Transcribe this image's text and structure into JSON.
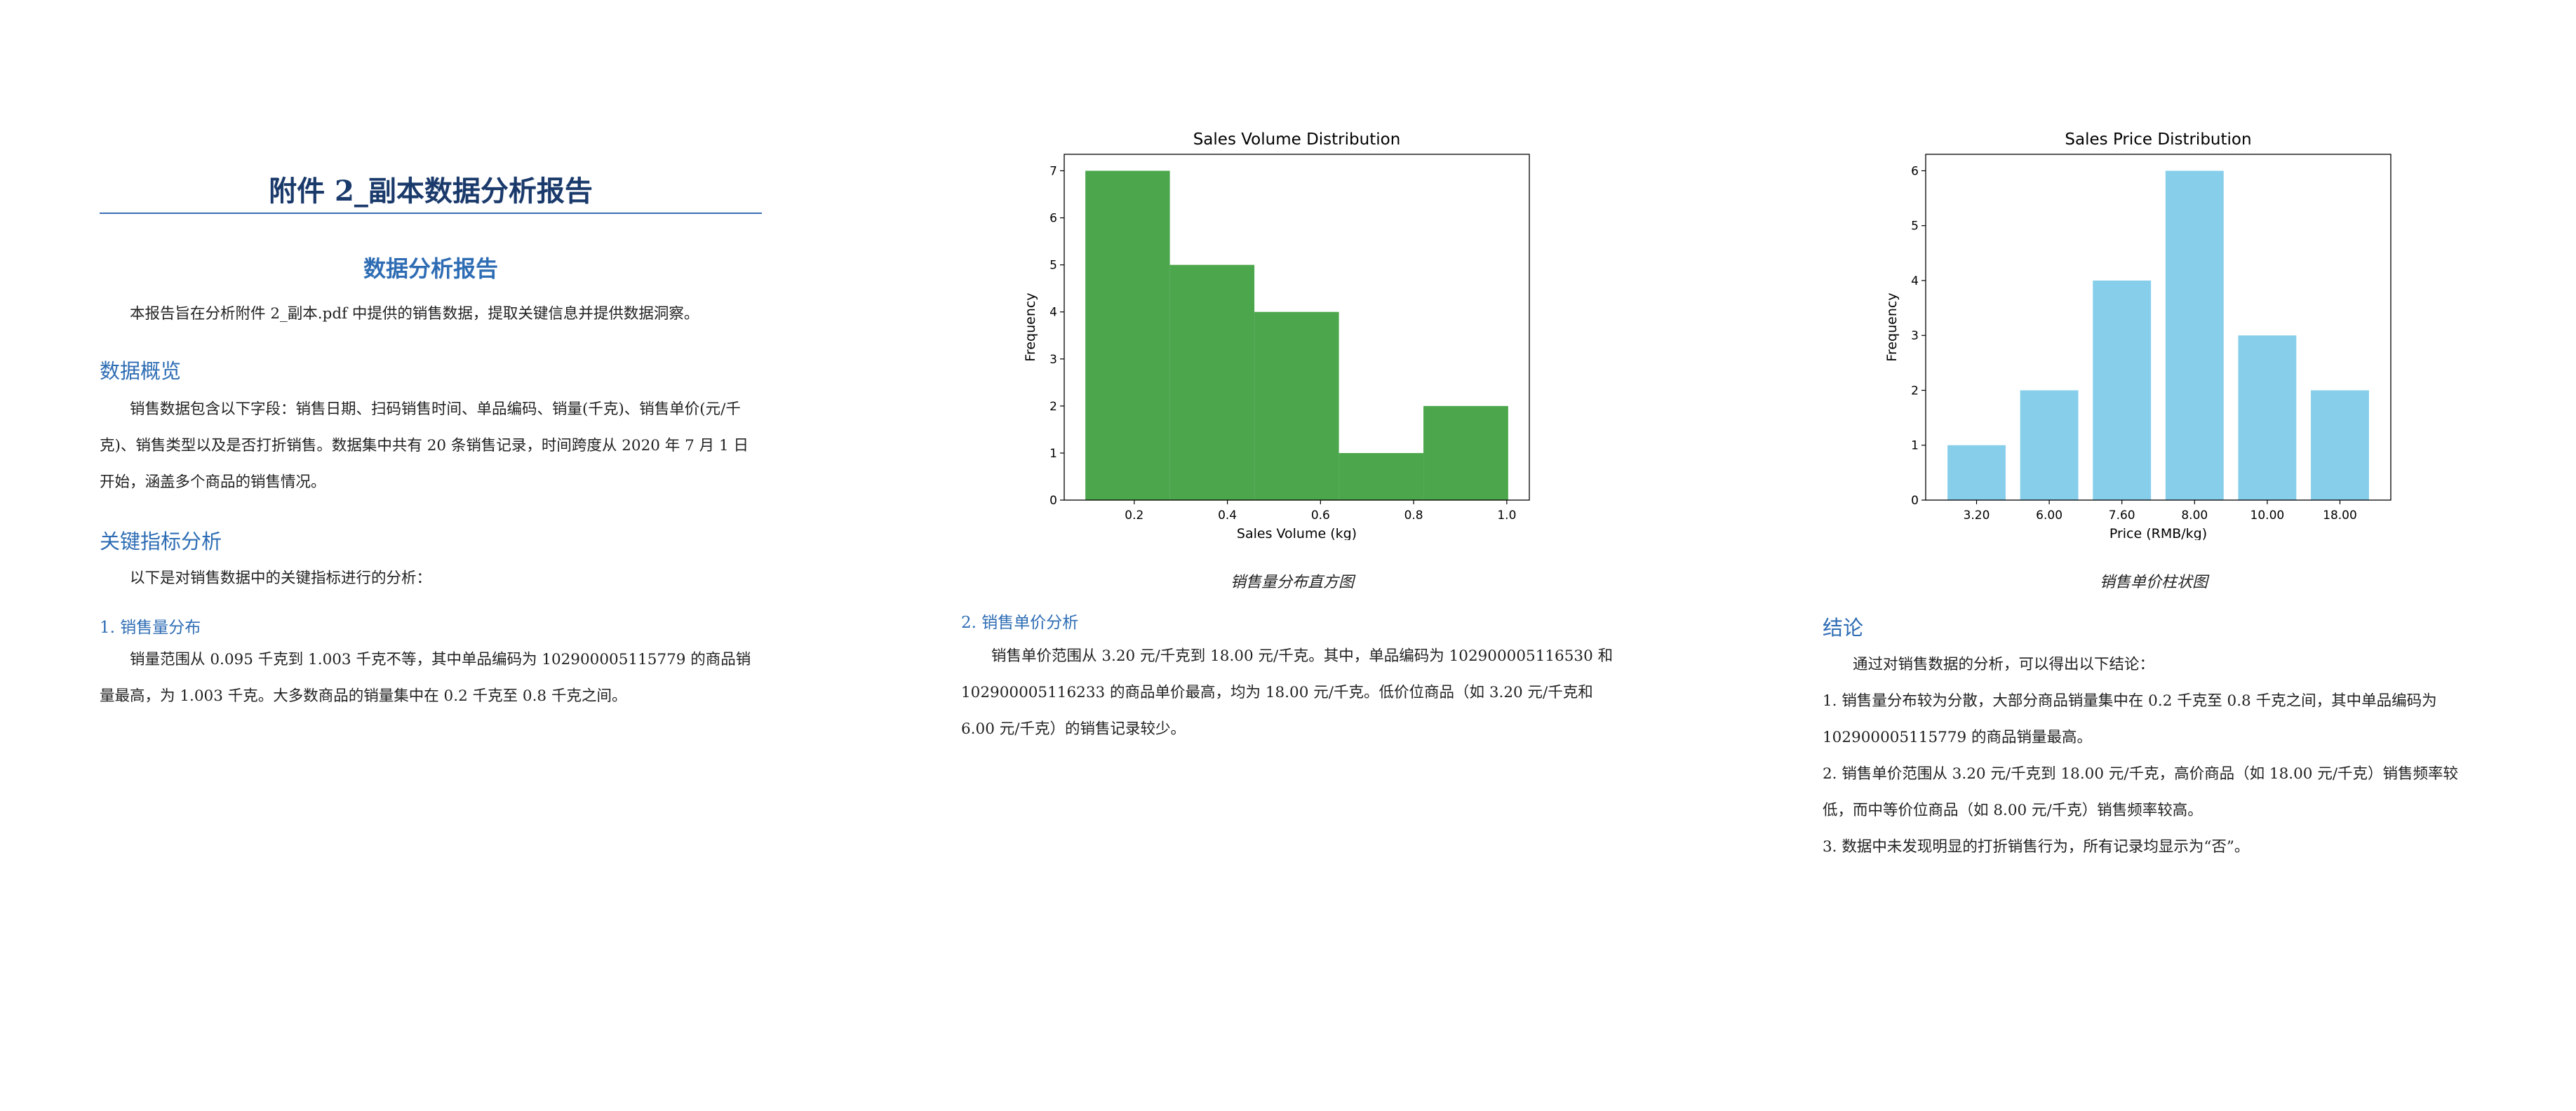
{
  "doc_title": "附件 2_副本数据分析报告",
  "report_subtitle": "数据分析报告",
  "intro": "本报告旨在分析附件 2_副本.pdf 中提供的销售数据，提取关键信息并提供数据洞察。",
  "overview": {
    "heading": "数据概览",
    "text": "销售数据包含以下字段：销售日期、扫码销售时间、单品编码、销量(千克)、销售单价(元/千克)、销售类型以及是否打折销售。数据集中共有 20 条销售记录，时间跨度从 2020 年 7 月 1 日开始，涵盖多个商品的销售情况。"
  },
  "metrics": {
    "heading": "关键指标分析",
    "intro": "以下是对销售数据中的关键指标进行的分析：",
    "volume_heading": "1. 销售量分布",
    "volume_text": "销量范围从 0.095 千克到 1.003 千克不等，其中单品编码为 102900005115779 的商品销量最高，为 1.003 千克。大多数商品的销量集中在 0.2 千克至 0.8 千克之间。",
    "price_heading": "2. 销售单价分析",
    "price_text": "销售单价范围从 3.20 元/千克到 18.00 元/千克。其中，单品编码为 102900005116530 和 102900005116233 的商品单价最高，均为 18.00 元/千克。低价位商品（如 3.20 元/千克和 6.00 元/千克）的销售记录较少。"
  },
  "captions": {
    "volume": "销售量分布直方图",
    "price": "销售单价柱状图"
  },
  "conclusion": {
    "heading": "结论",
    "intro": "通过对销售数据的分析，可以得出以下结论：",
    "items": [
      "1. 销售量分布较为分散，大部分商品销量集中在 0.2 千克至 0.8 千克之间，其中单品编码为 102900005115779 的商品销量最高。",
      "2. 销售单价范围从 3.20 元/千克到 18.00 元/千克，高价商品（如 18.00 元/千克）销售频率较低，而中等价位商品（如 8.00 元/千克）销售频率较高。",
      "3. 数据中未发现明显的打折销售行为，所有记录均显示为“否”。"
    ]
  },
  "chart_data": [
    {
      "type": "bar",
      "title": "Sales Volume Distribution",
      "xlabel": "Sales Volume (kg)",
      "ylabel": "Frequency",
      "bins": [
        0.095,
        0.2765,
        0.458,
        0.6395,
        0.821,
        1.003
      ],
      "values": [
        7,
        5,
        4,
        1,
        2
      ],
      "xticks": [
        0.2,
        0.4,
        0.6,
        0.8,
        1.0
      ],
      "xtick_labels": [
        "0.2",
        "0.4",
        "0.6",
        "0.8",
        "1.0"
      ],
      "xlim": [
        0.0496,
        1.0484
      ],
      "ylim": [
        0,
        7.35
      ],
      "yticks": [
        0,
        1,
        2,
        3,
        4,
        5,
        6,
        7
      ],
      "color": "#4ca64c"
    },
    {
      "type": "bar",
      "title": "Sales Price Distribution",
      "xlabel": "Price (RMB/kg)",
      "ylabel": "Frequency",
      "categories": [
        "3.20",
        "6.00",
        "7.60",
        "8.00",
        "10.00",
        "18.00"
      ],
      "values": [
        1,
        2,
        4,
        6,
        3,
        2
      ],
      "ylim": [
        0,
        6.3
      ],
      "yticks": [
        0,
        1,
        2,
        3,
        4,
        5,
        6
      ],
      "color": "#87ceeb"
    }
  ]
}
